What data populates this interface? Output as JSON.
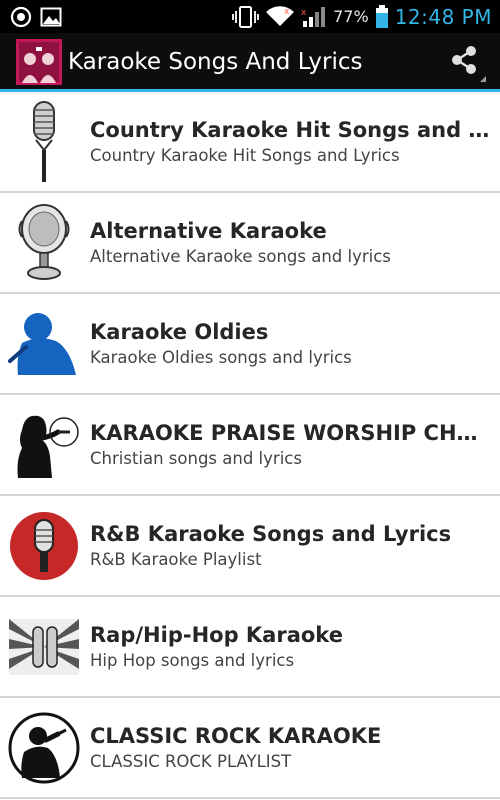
{
  "status_bar": {
    "battery_percent": "77%",
    "time": "12:48 PM",
    "icons": [
      "target-icon",
      "image-icon",
      "vibrate-icon",
      "wifi-icon",
      "signal-icon",
      "battery-icon"
    ]
  },
  "action_bar": {
    "title": "Karaoke Songs And Lyrics",
    "app_icon": "karaoke-app-icon",
    "share_icon": "share-icon",
    "accent_color": "#33b5e5"
  },
  "items": [
    {
      "title": "Country Karaoke Hit Songs and Lyrics",
      "subtitle": "Country Karaoke Hit Songs and Lyrics",
      "icon": "vintage-microphone-icon"
    },
    {
      "title": "Alternative Karaoke",
      "subtitle": "Alternative Karaoke songs and lyrics",
      "icon": "studio-microphone-icon"
    },
    {
      "title": "Karaoke Oldies",
      "subtitle": "Karaoke Oldies songs and lyrics",
      "icon": "singer-silhouette-icon"
    },
    {
      "title": "KARAOKE PRAISE WORSHIP CHRISTIAN",
      "subtitle": "Christian songs and lyrics",
      "icon": "woman-singer-icon"
    },
    {
      "title": "R&B Karaoke Songs and Lyrics",
      "subtitle": "R&B Karaoke Playlist",
      "icon": "red-microphone-icon"
    },
    {
      "title": "Rap/Hip-Hop Karaoke",
      "subtitle": "Hip Hop songs and lyrics",
      "icon": "two-microphones-icon"
    },
    {
      "title": "CLASSIC ROCK KARAOKE",
      "subtitle": "CLASSIC ROCK PLAYLIST",
      "icon": "rock-singer-icon"
    }
  ]
}
